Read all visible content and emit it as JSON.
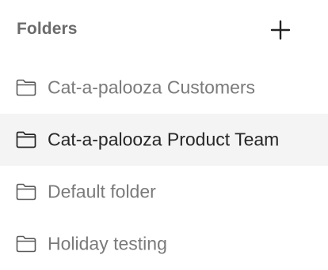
{
  "header": {
    "title": "Folders",
    "add_icon": "plus-icon"
  },
  "folders": [
    {
      "label": "Cat-a-palooza Customers",
      "icon": "folder-icon",
      "selected": false
    },
    {
      "label": "Cat-a-palooza Product Team",
      "icon": "folder-icon",
      "selected": true
    },
    {
      "label": "Default folder",
      "icon": "folder-icon",
      "selected": false
    },
    {
      "label": "Holiday testing",
      "icon": "folder-icon",
      "selected": false
    }
  ],
  "colors": {
    "title": "#6b6b6b",
    "item_text": "#7a7a7a",
    "item_text_selected": "#262626",
    "selected_background": "#f4f4f4",
    "icon_stroke": "#4a4a4a"
  }
}
